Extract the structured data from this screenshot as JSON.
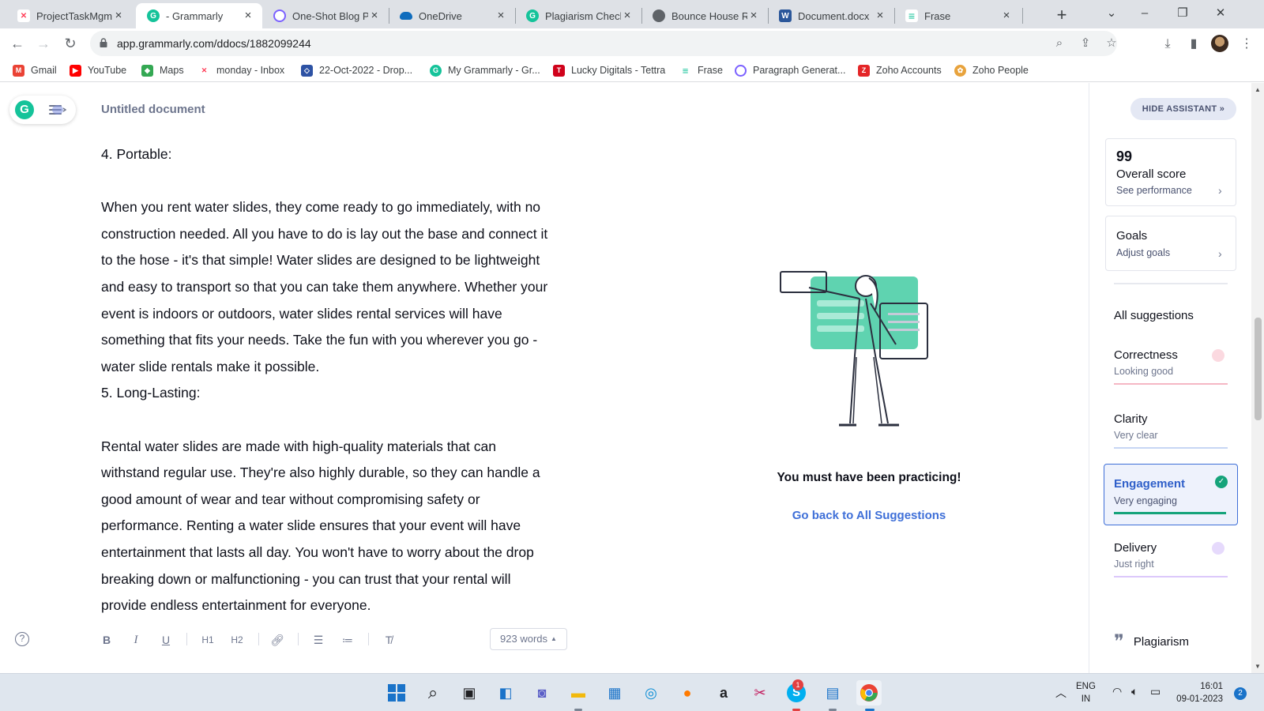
{
  "browser": {
    "tabs": [
      {
        "title": "ProjectTaskMgmt",
        "favicon": "monday-icon",
        "color": "#ff3d57"
      },
      {
        "title": "- Grammarly",
        "favicon": "grammarly-icon",
        "color": "#15c39a"
      },
      {
        "title": "One-Shot Blog Po",
        "favicon": "blog-icon",
        "color": "#7b61ff"
      },
      {
        "title": "OneDrive",
        "favicon": "onedrive-icon",
        "color": "#0f6cbd"
      },
      {
        "title": "Plagiarism Check",
        "favicon": "grammarly-icon",
        "color": "#15c39a"
      },
      {
        "title": "Bounce House Re",
        "favicon": "globe-icon",
        "color": "#5f6368"
      },
      {
        "title": "Document.docx",
        "favicon": "word-icon",
        "color": "#2b579a"
      },
      {
        "title": "Frase",
        "favicon": "frase-icon",
        "color": "#15c39a"
      }
    ],
    "url": "app.grammarly.com/ddocs/1882099244",
    "bookmarks": [
      {
        "label": "Gmail",
        "color": "#ea4335"
      },
      {
        "label": "YouTube",
        "color": "#ff0000"
      },
      {
        "label": "Maps",
        "color": "#34a853"
      },
      {
        "label": "monday - Inbox",
        "color": "#ff3d57"
      },
      {
        "label": "22-Oct-2022 - Drop...",
        "color": "#2d52a4"
      },
      {
        "label": "My Grammarly - Gr...",
        "color": "#15c39a"
      },
      {
        "label": "Lucky Digitals - Tettra",
        "color": "#d0021b"
      },
      {
        "label": "Frase",
        "color": "#15c39a"
      },
      {
        "label": "Paragraph Generat...",
        "color": "#7b61ff"
      },
      {
        "label": "Zoho Accounts",
        "color": "#e42527"
      },
      {
        "label": "Zoho People",
        "color": "#e8a33d"
      }
    ]
  },
  "document": {
    "title": "Untitled document",
    "paragraphs": [
      {
        "lines": [
          "4. Portable:"
        ]
      },
      {
        "lines": [
          ""
        ]
      },
      {
        "lines": [
          "When you rent water slides, they come ready to go immediately, with no",
          "construction needed. All you have to do is lay out the base and connect it",
          "to the hose - it's that simple! Water slides are designed to be lightweight",
          "and easy to transport so that you can take them anywhere. Whether your",
          "event is indoors or outdoors, water slides rental services will have",
          "something that fits your needs. Take the fun with you wherever you go -",
          "water slide rentals make it possible."
        ]
      },
      {
        "lines": [
          "5. Long-Lasting:"
        ]
      },
      {
        "lines": [
          ""
        ]
      },
      {
        "lines": [
          "Rental water slides are made with high-quality materials that can",
          "withstand regular use. They're also highly durable, so they can handle a",
          "good amount of wear and tear without compromising safety or",
          "performance. Renting a water slide ensures that your event will have",
          "entertainment that lasts all day. You won't have to worry about the drop",
          "breaking down or malfunctioning - you can trust that your rental will",
          "provide endless entertainment for everyone."
        ]
      }
    ],
    "word_count": "923 words",
    "format_buttons": [
      "B",
      "I",
      "U",
      "H1",
      "H2"
    ]
  },
  "assistant": {
    "congrats": "You must have been practicing!",
    "back_link": "Go back to All Suggestions",
    "hide_label": "HIDE ASSISTANT",
    "score": "99",
    "score_label": "Overall score",
    "score_link": "See performance",
    "goals_label": "Goals",
    "goals_link": "Adjust goals",
    "all_suggestions": "All suggestions",
    "categories": [
      {
        "label": "Correctness",
        "status": "Looking good",
        "color": "#e84b6b"
      },
      {
        "label": "Clarity",
        "status": "Very clear",
        "color": "#3e6fd8"
      },
      {
        "label": "Engagement",
        "status": "Very engaging",
        "color": "#15a37a"
      },
      {
        "label": "Delivery",
        "status": "Just right",
        "color": "#9b5cf5"
      }
    ],
    "plagiarism": "Plagiarism"
  },
  "taskbar": {
    "language": [
      "ENG",
      "IN"
    ],
    "time": "16:01",
    "date": "09-01-2023",
    "notification_count": "2",
    "skype_badge": "1"
  }
}
